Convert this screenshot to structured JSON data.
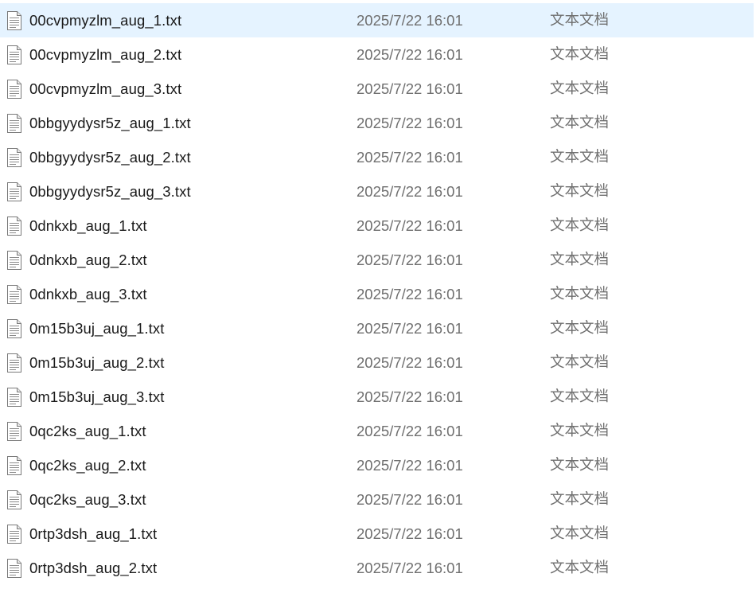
{
  "icons": {
    "file": "text-file-icon"
  },
  "colors": {
    "selection": "#e5f3ff",
    "name_text": "#1a1a1a",
    "meta_text": "#6f6f6f"
  },
  "files": [
    {
      "name": "00cvpmyzlm_aug_1.txt",
      "date": "2025/7/22 16:01",
      "type": "文本文档",
      "selected": true
    },
    {
      "name": "00cvpmyzlm_aug_2.txt",
      "date": "2025/7/22 16:01",
      "type": "文本文档",
      "selected": false
    },
    {
      "name": "00cvpmyzlm_aug_3.txt",
      "date": "2025/7/22 16:01",
      "type": "文本文档",
      "selected": false
    },
    {
      "name": "0bbgyydysr5z_aug_1.txt",
      "date": "2025/7/22 16:01",
      "type": "文本文档",
      "selected": false
    },
    {
      "name": "0bbgyydysr5z_aug_2.txt",
      "date": "2025/7/22 16:01",
      "type": "文本文档",
      "selected": false
    },
    {
      "name": "0bbgyydysr5z_aug_3.txt",
      "date": "2025/7/22 16:01",
      "type": "文本文档",
      "selected": false
    },
    {
      "name": "0dnkxb_aug_1.txt",
      "date": "2025/7/22 16:01",
      "type": "文本文档",
      "selected": false
    },
    {
      "name": "0dnkxb_aug_2.txt",
      "date": "2025/7/22 16:01",
      "type": "文本文档",
      "selected": false
    },
    {
      "name": "0dnkxb_aug_3.txt",
      "date": "2025/7/22 16:01",
      "type": "文本文档",
      "selected": false
    },
    {
      "name": "0m15b3uj_aug_1.txt",
      "date": "2025/7/22 16:01",
      "type": "文本文档",
      "selected": false
    },
    {
      "name": "0m15b3uj_aug_2.txt",
      "date": "2025/7/22 16:01",
      "type": "文本文档",
      "selected": false
    },
    {
      "name": "0m15b3uj_aug_3.txt",
      "date": "2025/7/22 16:01",
      "type": "文本文档",
      "selected": false
    },
    {
      "name": "0qc2ks_aug_1.txt",
      "date": "2025/7/22 16:01",
      "type": "文本文档",
      "selected": false
    },
    {
      "name": "0qc2ks_aug_2.txt",
      "date": "2025/7/22 16:01",
      "type": "文本文档",
      "selected": false
    },
    {
      "name": "0qc2ks_aug_3.txt",
      "date": "2025/7/22 16:01",
      "type": "文本文档",
      "selected": false
    },
    {
      "name": "0rtp3dsh_aug_1.txt",
      "date": "2025/7/22 16:01",
      "type": "文本文档",
      "selected": false
    },
    {
      "name": "0rtp3dsh_aug_2.txt",
      "date": "2025/7/22 16:01",
      "type": "文本文档",
      "selected": false
    }
  ]
}
